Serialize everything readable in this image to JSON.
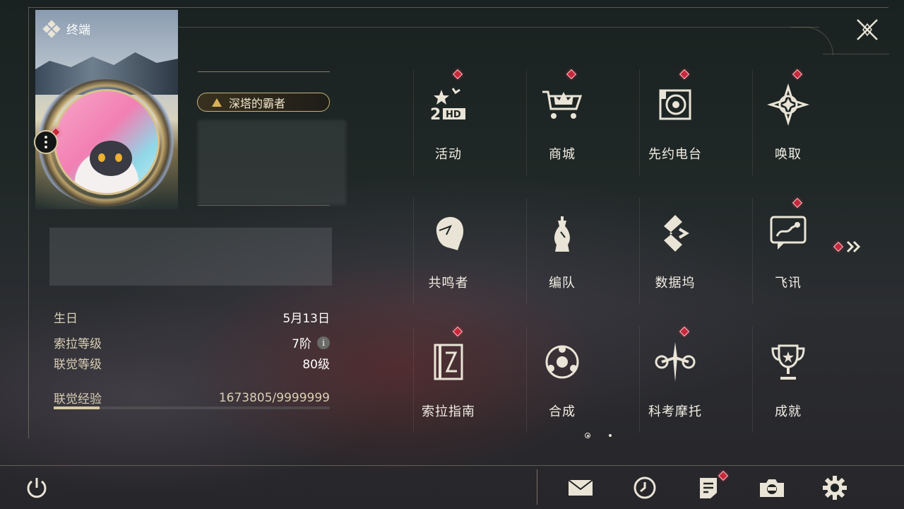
{
  "header": {
    "title": "终端"
  },
  "profile": {
    "title_badge": "深塔的霸者",
    "stats": [
      {
        "label": "生日",
        "value": "5月13日"
      },
      {
        "label": "索拉等级",
        "value": "7阶"
      },
      {
        "label": "联觉等级",
        "value": "80级"
      },
      {
        "label": "联觉经验",
        "value": "1673805/9999999"
      }
    ],
    "exp_progress": 0.1674
  },
  "grid": {
    "items": [
      {
        "label": "活动",
        "icon": "event-2hd-icon",
        "badge": true
      },
      {
        "label": "商城",
        "icon": "shop-crown-cart-icon",
        "badge": true
      },
      {
        "label": "先约电台",
        "icon": "radio-icon",
        "badge": true
      },
      {
        "label": "唤取",
        "icon": "convene-star-icon",
        "badge": true
      },
      {
        "label": "共鸣者",
        "icon": "resonator-head-icon",
        "badge": false
      },
      {
        "label": "编队",
        "icon": "chess-team-icon",
        "badge": false
      },
      {
        "label": "数据坞",
        "icon": "databank-icon",
        "badge": false
      },
      {
        "label": "飞讯",
        "icon": "message-chat-icon",
        "badge": true
      },
      {
        "label": "索拉指南",
        "icon": "guidebook-icon",
        "badge": true
      },
      {
        "label": "合成",
        "icon": "synthesis-icon",
        "badge": false
      },
      {
        "label": "科考摩托",
        "icon": "motorcycle-icon",
        "badge": true
      },
      {
        "label": "成就",
        "icon": "trophy-icon",
        "badge": false
      }
    ]
  },
  "colors": {
    "accent": "#d8c9a1",
    "badge": "#c8283a",
    "text": "#f2eee4"
  },
  "bottom_bar": {
    "icons": [
      "power-icon",
      "mail-icon",
      "clock-icon",
      "notice-icon",
      "camera-icon",
      "settings-gear-icon"
    ]
  },
  "pagination": {
    "current": 1,
    "total": 2
  }
}
